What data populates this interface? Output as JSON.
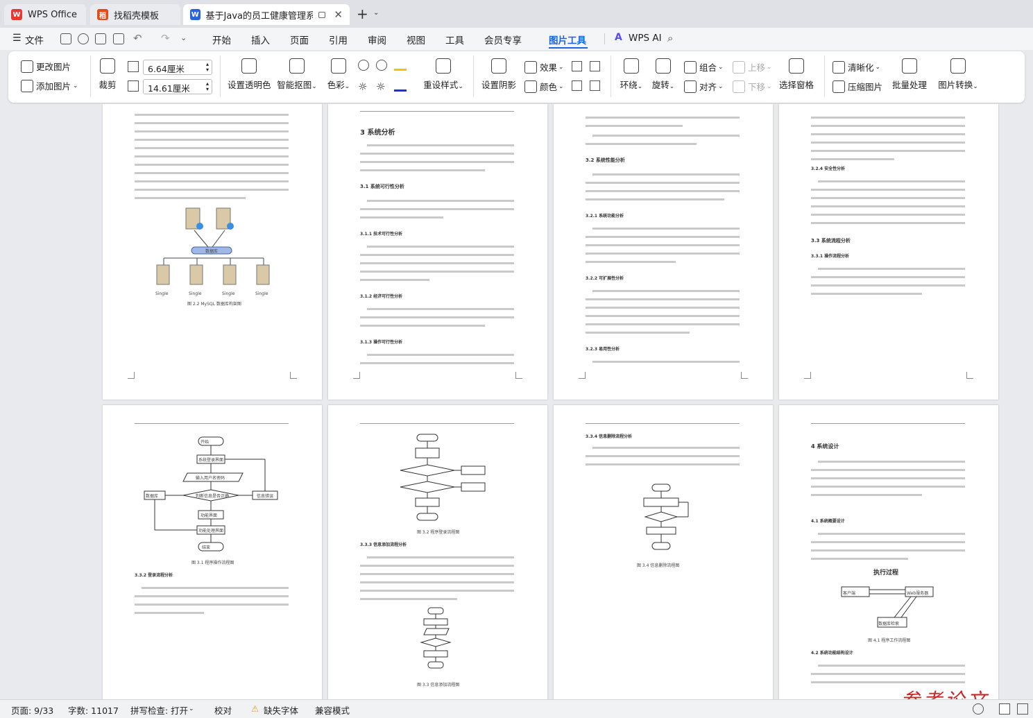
{
  "tabs": [
    {
      "label": "WPS Office"
    },
    {
      "label": "找稻壳模板"
    },
    {
      "label": "基于Java的员工健康管理系统"
    }
  ],
  "menu": {
    "file": "文件",
    "items": [
      "开始",
      "插入",
      "页面",
      "引用",
      "审阅",
      "视图",
      "工具",
      "会员专享",
      "图片工具"
    ],
    "wps_ai": "WPS AI"
  },
  "ribbon": {
    "change_pic": "更改图片",
    "add_pic": "添加图片",
    "crop": "裁剪",
    "height": "6.64厘米",
    "width": "14.61厘米",
    "set_transparent": "设置透明色",
    "smart_cutout": "智能抠图",
    "color_tone": "色彩",
    "reset_style": "重设样式",
    "set_shadow": "设置阴影",
    "effect": "效果",
    "color": "颜色",
    "wrap": "环绕",
    "rotate": "旋转",
    "group": "组合",
    "align": "对齐",
    "move_up": "上移",
    "move_down": "下移",
    "select_pane": "选择窗格",
    "sharpen": "清晰化",
    "compress": "压缩图片",
    "batch": "批量处理",
    "convert": "图片转换"
  },
  "pages": {
    "p1": {
      "caption": "图 2.2 MySQL 数据库构架图",
      "db_label": "数据库",
      "node": "Single"
    },
    "p2": {
      "h1": "3 系统分析",
      "h2": "3.1 系统可行性分析",
      "h3a": "3.1.1 技术可行性分析",
      "h3b": "3.1.2 经济可行性分析",
      "h3c": "3.1.3 操作可行性分析"
    },
    "p3": {
      "h2": "3.2 系统性能分析",
      "h3a": "3.2.1 系统功能分析",
      "h3b": "3.2.2 可扩展性分析",
      "h3c": "3.2.3 易用性分析"
    },
    "p4": {
      "h3a": "3.2.4 安全性分析",
      "h2": "3.3 系统流程分析",
      "h3b": "3.3.1 操作流程分析"
    },
    "p5": {
      "start": "开始",
      "login_ui": "系统登录界面",
      "input": "输入用户名密码",
      "db": "数据库",
      "judge": "判断信息是否正确",
      "err": "信息错误",
      "func": "功能界面",
      "handle": "功能处理界面",
      "end": "结束",
      "caption": "图 3.1 程序操作流程图",
      "h3": "3.3.2 登录流程分析"
    },
    "p6": {
      "caption1": "图 3.2 程序登录流程图",
      "h3": "3.3.3 信息添加流程分析",
      "caption2": "图 3.3 信息添加流程图"
    },
    "p7": {
      "h3": "3.3.4 信息删除流程分析",
      "caption": "图 3.4 信息删除流程图"
    },
    "p8": {
      "h1": "4 系统设计",
      "h2a": "4.1 系统概要设计",
      "fig_title": "执行过程",
      "client": "客户端",
      "server": "Web服务器",
      "db": "数据库检索",
      "caption": "图 4.1 程序工作流程图",
      "h2b": "4.2 系统功能结构设计"
    }
  },
  "status": {
    "page": "页面: 9/33",
    "words": "字数: 11017",
    "spell": "拼写检查: 打开",
    "proof": "校对",
    "missing_font": "缺失字体",
    "compat": "兼容模式"
  },
  "watermark": "参考论文"
}
